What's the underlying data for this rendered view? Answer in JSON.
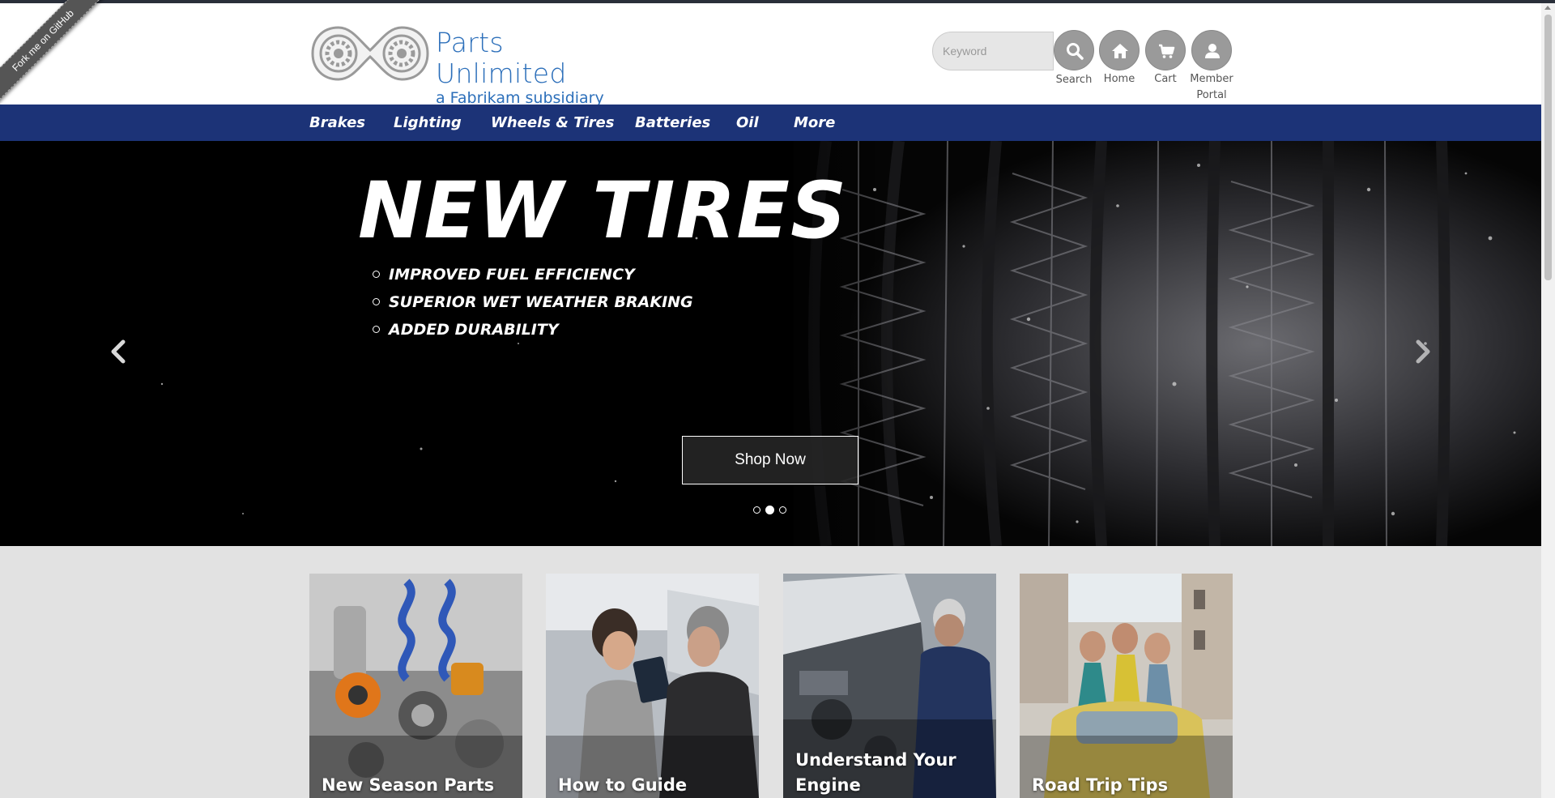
{
  "ribbon": {
    "label": "Fork me on GitHub"
  },
  "brand": {
    "title": "Parts Unlimited",
    "subtitle": "a Fabrikam subsidiary"
  },
  "search": {
    "placeholder": "Keyword",
    "label": "Search",
    "icon": "search-icon"
  },
  "header_buttons": [
    {
      "label": "Home",
      "icon": "home-icon"
    },
    {
      "label": "Cart",
      "icon": "cart-icon"
    },
    {
      "label": "Member",
      "label2": "Portal",
      "icon": "user-icon"
    }
  ],
  "nav": {
    "items": [
      "Brakes",
      "Lighting",
      "Wheels & Tires",
      "Batteries",
      "Oil",
      "More"
    ]
  },
  "hero": {
    "title": "NEW TIRES",
    "bullets": [
      "IMPROVED FUEL EFFICIENCY",
      "SUPERIOR WET WEATHER BRAKING",
      "ADDED DURABILITY"
    ],
    "cta": "Shop Now",
    "active_slide": 2,
    "slide_count": 3
  },
  "cards": [
    {
      "line1": "New Season Parts",
      "line2": ""
    },
    {
      "line1": "How to Guide",
      "line2": ""
    },
    {
      "line1": "Understand Your",
      "line2": "Engine"
    },
    {
      "line1": "Road Trip Tips",
      "line2": ""
    }
  ],
  "colors": {
    "nav": "#1c3377",
    "brand": "#2c6fba",
    "page_bg": "#e2e2e2"
  }
}
